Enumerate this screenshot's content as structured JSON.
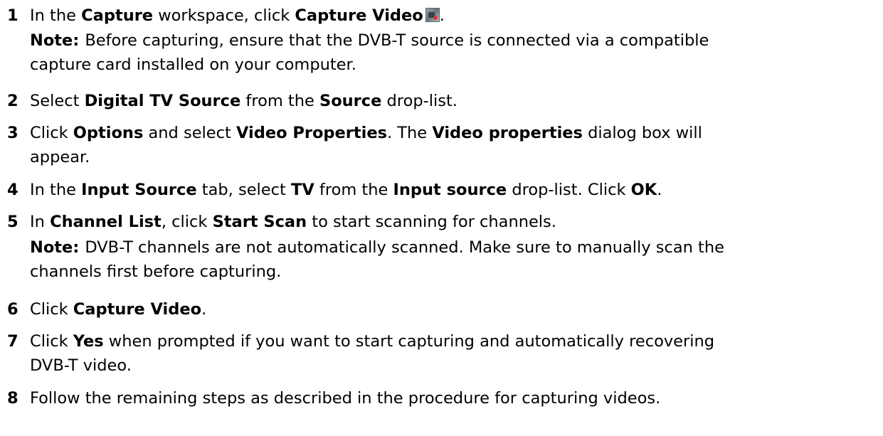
{
  "steps": [
    {
      "number": "1",
      "parts": [
        "In the ",
        "Capture",
        " workspace, click ",
        "Capture Video",
        "."
      ],
      "icon": "capture-video-icon",
      "note": {
        "label": "Note:",
        "line1": "Before capturing, ensure that the DVB-T source is connected via a compatible",
        "line2": "capture card installed on your computer."
      }
    },
    {
      "number": "2",
      "parts": [
        "Select ",
        "Digital TV Source",
        " from the ",
        "Source",
        " drop-list."
      ]
    },
    {
      "number": "3",
      "parts": [
        "Click ",
        "Options",
        " and select ",
        "Video Properties",
        ". The ",
        "Video properties",
        " dialog box will"
      ],
      "line2": "appear."
    },
    {
      "number": "4",
      "parts": [
        "In the ",
        "Input Source",
        " tab, select ",
        "TV",
        " from the ",
        "Input source",
        " drop-list. Click ",
        "OK",
        "."
      ]
    },
    {
      "number": "5",
      "parts": [
        "In ",
        "Channel List",
        ", click ",
        "Start Scan",
        " to start scanning for channels."
      ],
      "note": {
        "label": "Note:",
        "line1": "DVB-T channels are not automatically scanned. Make sure to manually scan the",
        "line2": "channels first before capturing."
      }
    },
    {
      "number": "6",
      "parts": [
        "Click ",
        "Capture Video",
        "."
      ]
    },
    {
      "number": "7",
      "parts": [
        "Click ",
        "Yes",
        " when prompted if you want to start capturing and automatically recovering"
      ],
      "line2": "DVB-T video."
    },
    {
      "number": "8",
      "parts": [
        "Follow the remaining steps as described in the procedure for capturing videos."
      ]
    }
  ]
}
